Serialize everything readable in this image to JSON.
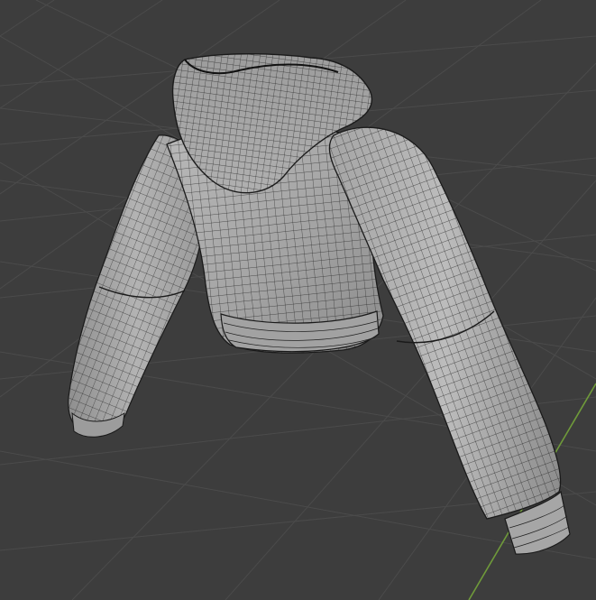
{
  "viewport": {
    "background_color": "#3d3d3d",
    "grid_color": "#4a4a4a",
    "axis_y_color": "#6f9a3a",
    "view_mode": "wireframe-on-shaded",
    "object": {
      "type": "cropped hoodie mesh",
      "shading_color": "#a9a9a9",
      "wire_color": "#1a1a1a"
    }
  }
}
